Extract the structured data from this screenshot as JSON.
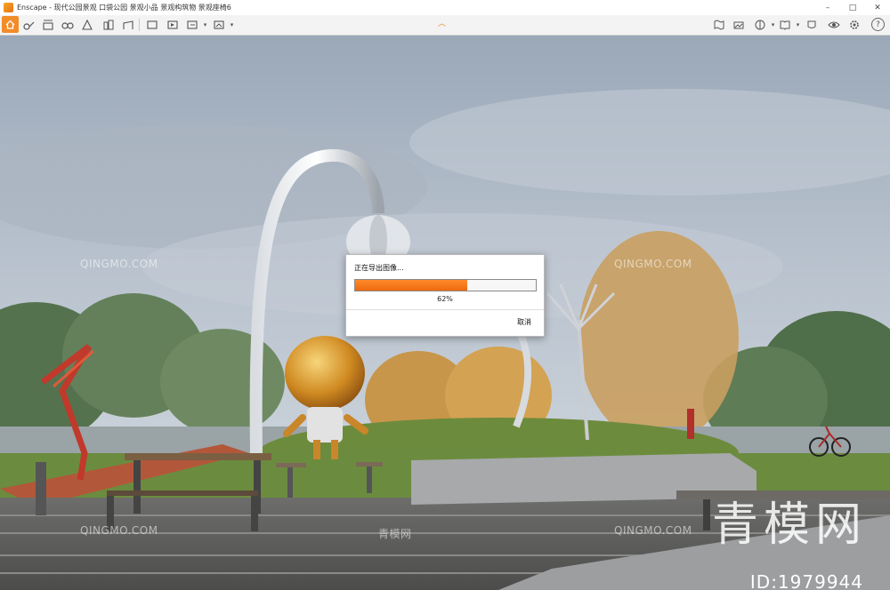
{
  "window": {
    "title": "Enscape - 现代公园景观 口袋公园 景观小品 景观构筑物 景观座椅6",
    "minimize": "–",
    "maximize": "□",
    "close": "✕"
  },
  "toolbar": {
    "help_label": "?",
    "left_icons": [
      "home-icon",
      "walk-mode-icon",
      "bim-icon",
      "binoculars-icon",
      "camera-icon",
      "scene-icon",
      "buildings-icon",
      "sun-icon",
      "screenshot-icon",
      "video-icon",
      "export-icon",
      "collaborate-icon"
    ],
    "right_icons": [
      "map-icon",
      "panorama-icon",
      "atmosphere-icon",
      "view-icon",
      "book-icon",
      "cup-icon",
      "eye-icon",
      "settings-icon"
    ]
  },
  "dialog": {
    "title": "正在导出图像...",
    "progress_percent": 62,
    "progress_label": "62%",
    "cancel_label": "取消"
  },
  "watermarks": {
    "brand_latin": "QINGMO.COM",
    "brand_cn": "青模网",
    "large_cn": "青模网",
    "id_label": "ID:1979944"
  },
  "colors": {
    "accent": "#f28c28",
    "progress": "#ee6a0e"
  }
}
